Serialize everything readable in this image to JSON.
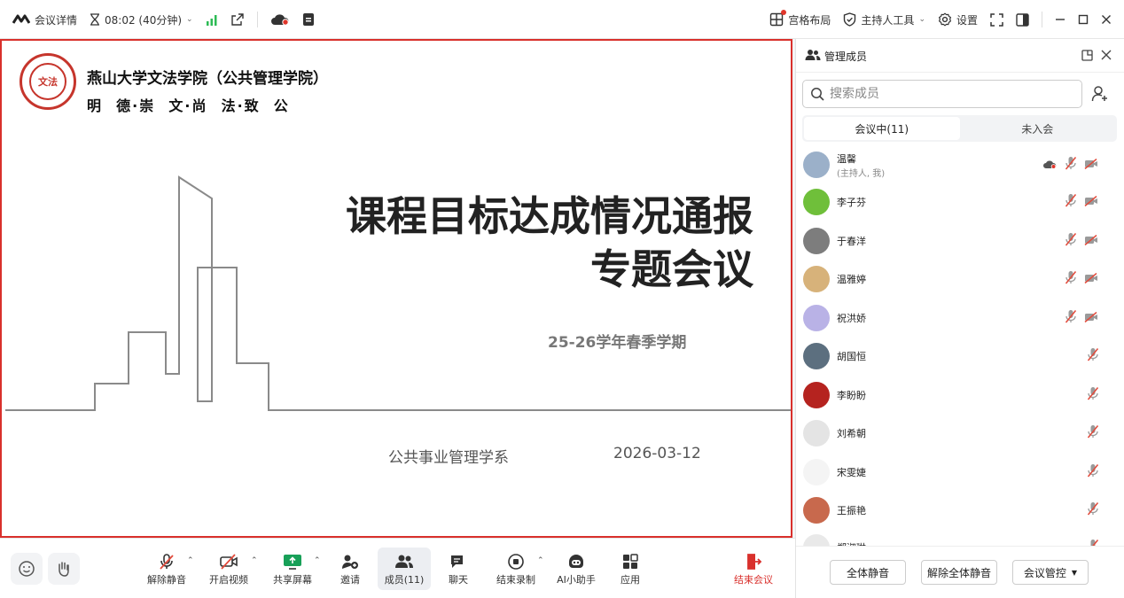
{
  "titlebar": {
    "meeting_details": "会议详情",
    "duration": "08:02 (40分钟)",
    "grid_layout": "宫格布局",
    "host_tools": "主持人工具",
    "settings": "设置"
  },
  "slide": {
    "school_name": "燕山大学文法学院（公共管理学院）",
    "motto": "明  德·崇  文·尚  法·致  公",
    "logo_text": "文法",
    "title_line1": "课程目标达成情况通报",
    "title_line2": "专题会议",
    "term": "25-26学年春季学期",
    "department": "公共事业管理学系",
    "date": "2026-03-12"
  },
  "toolbar": {
    "unmute": "解除静音",
    "start_video": "开启视频",
    "share_screen": "共享屏幕",
    "invite": "邀请",
    "members": "成员(11)",
    "chat": "聊天",
    "stop_recording": "结束录制",
    "ai_assistant": "AI小助手",
    "apps": "应用",
    "end_meeting": "结束会议"
  },
  "panel": {
    "title": "管理成员",
    "search_placeholder": "搜索成员",
    "tabs": [
      "会议中(11)",
      "未入会"
    ],
    "members": [
      {
        "name": "温馨",
        "sub": "(主持人, 我)",
        "avatar_color": "#9bb0c9"
      },
      {
        "name": "李子芬",
        "sub": "",
        "avatar_color": "#6fbf3a"
      },
      {
        "name": "于春洋",
        "sub": "",
        "avatar_color": "#7d7d7d"
      },
      {
        "name": "温雅婷",
        "sub": "",
        "avatar_color": "#d7b27a"
      },
      {
        "name": "祝洪娇",
        "sub": "",
        "avatar_color": "#b9b2e6"
      },
      {
        "name": "胡国恒",
        "sub": "",
        "avatar_color": "#5c6f7f"
      },
      {
        "name": "李盼盼",
        "sub": "",
        "avatar_color": "#b5231f"
      },
      {
        "name": "刘希朝",
        "sub": "",
        "avatar_color": "#e4e4e4"
      },
      {
        "name": "宋雯婕",
        "sub": "",
        "avatar_color": "#f4f4f4"
      },
      {
        "name": "王振艳",
        "sub": "",
        "avatar_color": "#c8694d"
      },
      {
        "name": "郑淑琳",
        "sub": "",
        "avatar_color": "#e9e9e9"
      }
    ],
    "mute_all": "全体静音",
    "unmute_all": "解除全体静音",
    "meeting_control": "会议管控"
  },
  "colors": {
    "accent_red": "#d9302c",
    "signal_green": "#2dbb55",
    "muted_icon_red": "#e24a3b",
    "share_green": "#18a058"
  }
}
